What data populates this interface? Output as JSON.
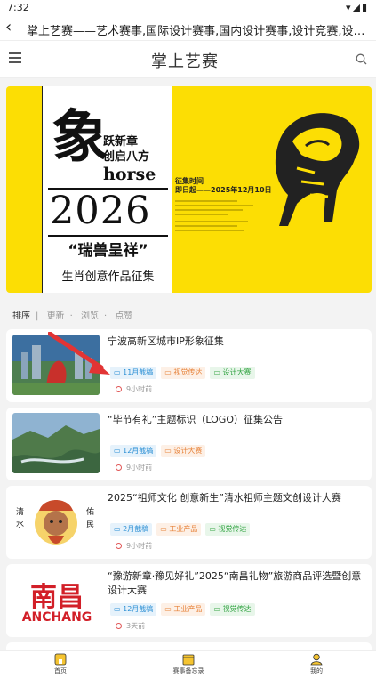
{
  "status_bar": {
    "time": "7:32"
  },
  "titlebar": {
    "title": "掌上艺赛——艺术赛事,国际设计赛事,国内设计赛事,设计竞赛,设计比赛,设计"
  },
  "topnav": {
    "logo": "掌上艺赛"
  },
  "banner": {
    "poster_char": "象",
    "slogan": [
      "跃新章",
      "创启八方"
    ],
    "horse_word": "horse",
    "year": "2026",
    "tagline": "“瑞兽呈祥”",
    "subtitle": "生肖创意作品征集",
    "deadline_heading": "征集时间",
    "deadline": "即日起——2025年12月10日"
  },
  "filters": {
    "sort_label": "排序",
    "items": [
      "更新",
      "浏览",
      "点赞"
    ]
  },
  "cards": [
    {
      "title": "宁波高新区城市IP形象征集",
      "tags": [
        {
          "text": "11月截稿",
          "color": "blue"
        },
        {
          "text": "视觉传达",
          "color": "orange"
        },
        {
          "text": "设计大赛",
          "color": "green"
        }
      ],
      "time": "9小时前"
    },
    {
      "title": "“毕节有礼”主题标识（LOGO）征集公告",
      "tags": [
        {
          "text": "12月截稿",
          "color": "blue"
        },
        {
          "text": "设计大赛",
          "color": "orange"
        }
      ],
      "time": "9小时前"
    },
    {
      "title": "2025“祖师文化 创意新生”清水祖师主题文创设计大赛",
      "tags": [
        {
          "text": "2月截稿",
          "color": "blue"
        },
        {
          "text": "工业产品",
          "color": "orange"
        },
        {
          "text": "视觉传达",
          "color": "green"
        }
      ],
      "time": "9小时前",
      "thumb_text": [
        "清",
        "水",
        "佑",
        "民"
      ]
    },
    {
      "title": "“豫游新章·豫见好礼”2025“南昌礼物”旅游商品评选暨创意设计大赛",
      "tags": [
        {
          "text": "12月截稿",
          "color": "blue"
        },
        {
          "text": "工业产品",
          "color": "orange"
        },
        {
          "text": "视觉传达",
          "color": "green"
        }
      ],
      "time": "3天前",
      "thumb_text": [
        "南昌",
        "ANCHANG"
      ]
    }
  ],
  "tabbar": {
    "home": "首页",
    "calendar": "赛事备忘录",
    "mine": "我的"
  },
  "colors": {
    "banner_yellow": "#fcde04",
    "tag_blue": "#2b8fd4",
    "tag_orange": "#e7833b",
    "tag_green": "#33a443",
    "arrow_red": "#e23434"
  }
}
